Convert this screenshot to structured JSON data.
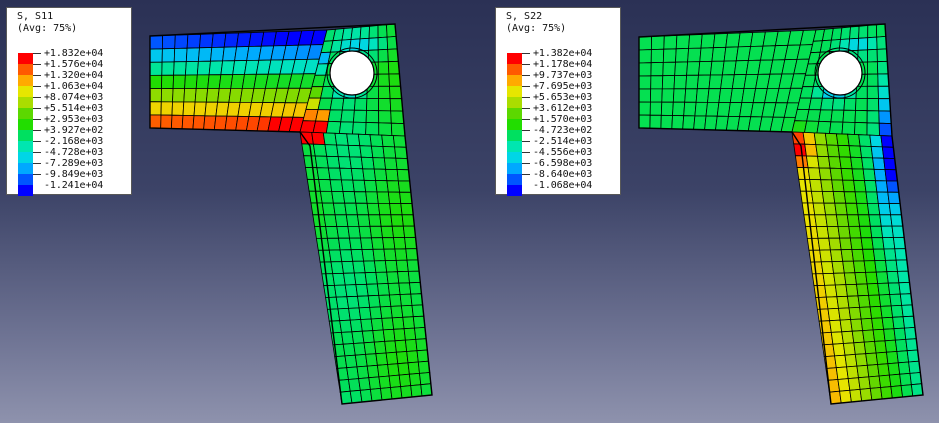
{
  "plots": [
    {
      "title": "S, S11",
      "subtitle": "(Avg: 75%)",
      "values": [
        "+1.832e+04",
        "+1.576e+04",
        "+1.320e+04",
        "+1.063e+04",
        "+8.074e+03",
        "+5.514e+03",
        "+2.953e+03",
        "+3.927e+02",
        "-2.168e+03",
        "-4.728e+03",
        "-7.289e+03",
        "-9.849e+03",
        "-1.241e+04"
      ]
    },
    {
      "title": "S, S22",
      "subtitle": "(Avg: 75%)",
      "values": [
        "+1.382e+04",
        "+1.178e+04",
        "+9.737e+03",
        "+7.695e+03",
        "+5.653e+03",
        "+3.612e+03",
        "+1.570e+03",
        "-4.723e+02",
        "-2.514e+03",
        "-4.556e+03",
        "-6.598e+03",
        "-8.640e+03",
        "-1.068e+04"
      ]
    }
  ],
  "colors": {
    "contour": [
      "#ff0000",
      "#ff5a00",
      "#ffaa00",
      "#e6e600",
      "#aadd00",
      "#5cd800",
      "#22dd00",
      "#00e060",
      "#00e6b0",
      "#00d6e6",
      "#00a8ff",
      "#0056ff",
      "#0000ff"
    ],
    "mesh": "#000000",
    "background_top": "#2b3155",
    "background_bottom": "#8e92ad"
  }
}
